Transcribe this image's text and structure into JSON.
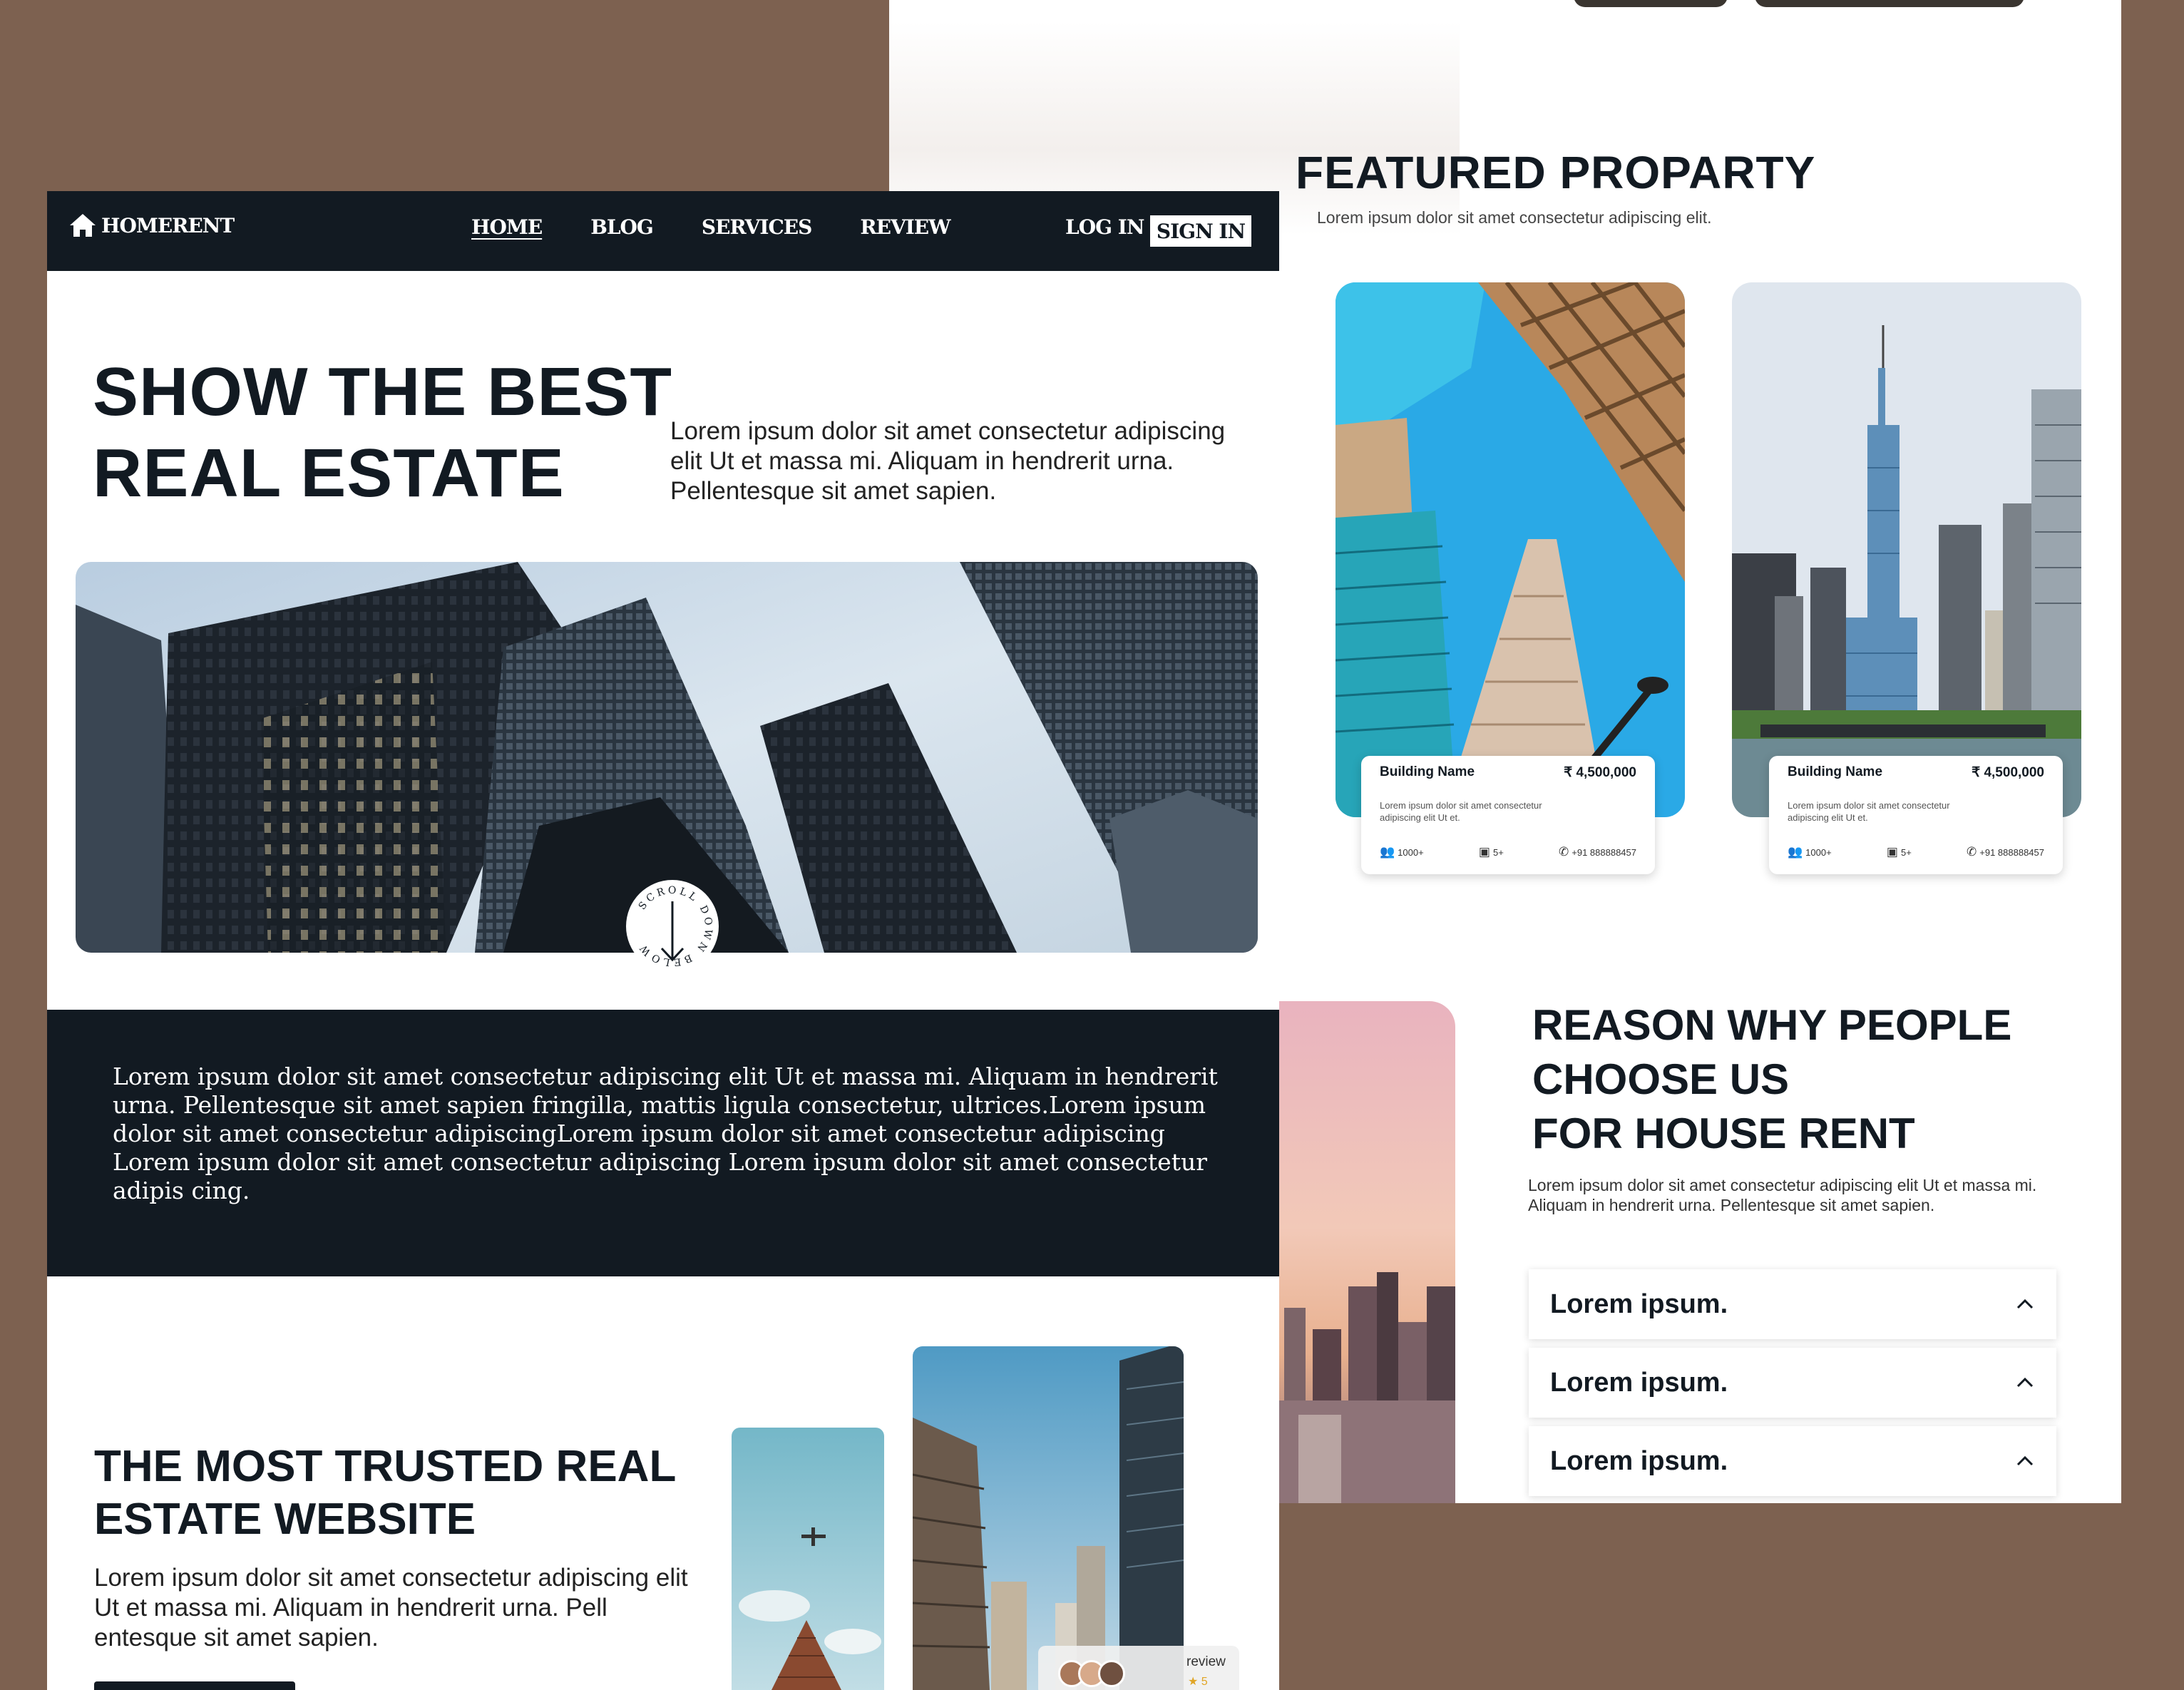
{
  "nav": {
    "logo": "HOMERENT",
    "links": [
      "HOME",
      "BLOG",
      "SERVICES",
      "REVIEW"
    ],
    "login": "LOG IN",
    "signin": "SIGN IN"
  },
  "hero": {
    "title_line1": "SHOW THE BEST",
    "title_line2": "REAL ESTATE",
    "subtitle": "Lorem ipsum dolor sit amet consectetur adipiscing elit Ut et massa mi. Aliquam in hendrerit urna. Pellentesque sit amet sapien.",
    "scroll_text": "SCROLL DOWN BELOW"
  },
  "band": {
    "text": "Lorem ipsum dolor sit amet consectetur adipiscing elit Ut et massa mi. Aliquam in hendrerit urna. Pellentesque sit amet sapien fringilla, mattis ligula consectetur, ultrices.Lorem ipsum dolor sit amet consectetur adipiscingLorem ipsum dolor sit amet consectetur adipiscing Lorem ipsum dolor sit amet consectetur adipiscing Lorem ipsum dolor sit amet consectetur adipis cing."
  },
  "trusted": {
    "title_line1": "THE MOST TRUSTED REAL",
    "title_line2": "ESTATE WEBSITE",
    "text": "Lorem ipsum dolor sit amet consectetur adipiscing elit Ut et massa mi. Aliquam in hendrerit urna. Pell entesque sit amet sapien.",
    "review_label": "review",
    "review_stars": "★ 5"
  },
  "featured": {
    "title": "FEATURED PROPARTY",
    "subtitle": "Lorem ipsum dolor sit amet consectetur adipiscing elit.",
    "cards": [
      {
        "name": "Building Name",
        "price": "₹ 4,500,000",
        "desc": "Lorem ipsum dolor sit amet consectetur adipiscing elit Ut et.",
        "people": "1000+",
        "rooms": "5+",
        "phone": "+91 888888457"
      },
      {
        "name": "Building Name",
        "price": "₹ 4,500,000",
        "desc": "Lorem ipsum dolor sit amet consectetur adipiscing elit Ut et.",
        "people": "1000+",
        "rooms": "5+",
        "phone": "+91 888888457"
      }
    ]
  },
  "reason": {
    "title_line1": "REASON WHY PEOPLE",
    "title_line2": "CHOOSE US",
    "title_line3": "FOR HOUSE RENT",
    "subtitle": "Lorem ipsum dolor sit amet consectetur adipiscing elit Ut et massa mi. Aliquam in hendrerit urna. Pellentesque sit amet sapien.",
    "accordion": [
      "Lorem ipsum.",
      "Lorem ipsum.",
      "Lorem ipsum."
    ]
  },
  "colors": {
    "background": "#7d6150",
    "dark": "#121a22",
    "star": "#e0a526"
  }
}
